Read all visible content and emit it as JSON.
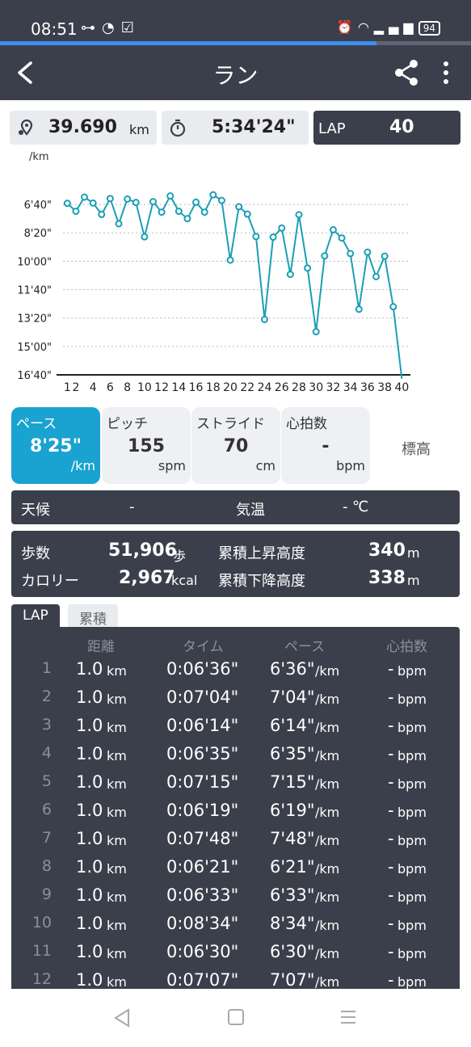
{
  "status": {
    "time": "08:51",
    "battery": "94",
    "progress_fraction": 0.8
  },
  "appbar": {
    "title": "ラン"
  },
  "stats": {
    "distance": "39.690",
    "distance_unit": "km",
    "time": "5:34'24\"",
    "lap_label": "LAP",
    "lap_value": "40"
  },
  "chart_data": {
    "type": "line",
    "ylabel": "/km",
    "y_ticks": [
      "6'40\"",
      "8'20\"",
      "10'00\"",
      "11'40\"",
      "13'20\"",
      "15'00\"",
      "16'40\""
    ],
    "y_tick_values_sec": [
      400,
      500,
      600,
      700,
      800,
      900,
      1000
    ],
    "ylim_sec": [
      340,
      1000
    ],
    "y_inverted": true,
    "x_ticks": [
      "1",
      "2",
      "4",
      "6",
      "8",
      "10",
      "12",
      "14",
      "16",
      "18",
      "20",
      "22",
      "24",
      "26",
      "28",
      "30",
      "32",
      "34",
      "36",
      "38",
      "40"
    ],
    "x_tick_values": [
      1,
      2,
      4,
      6,
      8,
      10,
      12,
      14,
      16,
      18,
      20,
      22,
      24,
      26,
      28,
      30,
      32,
      34,
      36,
      38,
      40
    ],
    "xlim": [
      0.5,
      41
    ],
    "series": [
      {
        "laps": [
          1,
          2,
          3,
          4,
          5,
          6,
          7,
          8,
          9,
          10,
          11,
          12,
          13,
          14,
          15,
          16,
          17,
          18,
          19,
          20,
          21,
          22,
          23,
          24,
          25,
          26,
          27,
          28,
          29,
          30,
          31,
          32,
          33,
          34,
          35,
          36,
          37,
          38,
          39,
          40
        ],
        "values_sec": [
          396,
          424,
          374,
          395,
          435,
          379,
          468,
          381,
          393,
          514,
          390,
          427,
          370,
          424,
          450,
          392,
          427,
          366,
          386,
          596,
          408,
          434,
          513,
          805,
          515,
          483,
          646,
          436,
          624,
          848,
          581,
          489,
          518,
          573,
          769,
          568,
          654,
          582,
          760,
          1100
        ]
      }
    ],
    "line_color": "#1a9fb5"
  },
  "metrics": [
    {
      "label": "ペース",
      "value": "8'25\"",
      "unit": "/km"
    },
    {
      "label": "ピッチ",
      "value": "155",
      "unit": "spm"
    },
    {
      "label": "ストライド",
      "value": "70",
      "unit": "cm"
    },
    {
      "label": "心拍数",
      "value": "-",
      "unit": "bpm"
    },
    {
      "label": "標高"
    }
  ],
  "weather": {
    "label1": "天候",
    "value1": "-",
    "label2": "気温",
    "value2": "-",
    "unit2": "℃"
  },
  "summary": {
    "steps_label": "歩数",
    "steps": "51,906",
    "steps_unit": "歩",
    "cal_label": "カロリー",
    "cal": "2,967",
    "cal_unit": "kcal",
    "up_label": "累積上昇高度",
    "up": "340",
    "up_unit": "m",
    "down_label": "累積下降高度",
    "down": "338",
    "down_unit": "m"
  },
  "tabs": {
    "lap": "LAP",
    "cumulative": "累積"
  },
  "laps": {
    "headers": [
      "距離",
      "タイム",
      "ペース",
      "心拍数"
    ],
    "km_unit": "km",
    "pace_unit": "/km",
    "hr_unit": "bpm",
    "rows": [
      {
        "n": "1",
        "dist": "1.0",
        "time": "0:06'36\"",
        "pace": "6'36\"",
        "hr": "-"
      },
      {
        "n": "2",
        "dist": "1.0",
        "time": "0:07'04\"",
        "pace": "7'04\"",
        "hr": "-"
      },
      {
        "n": "3",
        "dist": "1.0",
        "time": "0:06'14\"",
        "pace": "6'14\"",
        "hr": "-"
      },
      {
        "n": "4",
        "dist": "1.0",
        "time": "0:06'35\"",
        "pace": "6'35\"",
        "hr": "-"
      },
      {
        "n": "5",
        "dist": "1.0",
        "time": "0:07'15\"",
        "pace": "7'15\"",
        "hr": "-"
      },
      {
        "n": "6",
        "dist": "1.0",
        "time": "0:06'19\"",
        "pace": "6'19\"",
        "hr": "-"
      },
      {
        "n": "7",
        "dist": "1.0",
        "time": "0:07'48\"",
        "pace": "7'48\"",
        "hr": "-"
      },
      {
        "n": "8",
        "dist": "1.0",
        "time": "0:06'21\"",
        "pace": "6'21\"",
        "hr": "-"
      },
      {
        "n": "9",
        "dist": "1.0",
        "time": "0:06'33\"",
        "pace": "6'33\"",
        "hr": "-"
      },
      {
        "n": "10",
        "dist": "1.0",
        "time": "0:08'34\"",
        "pace": "8'34\"",
        "hr": "-"
      },
      {
        "n": "11",
        "dist": "1.0",
        "time": "0:06'30\"",
        "pace": "6'30\"",
        "hr": "-"
      },
      {
        "n": "12",
        "dist": "1.0",
        "time": "0:07'07\"",
        "pace": "7'07\"",
        "hr": "-"
      }
    ]
  },
  "icons": {
    "back": "back-arrow-icon",
    "share": "share-icon",
    "more": "more-vert-icon",
    "map_pin": "map-pin-icon",
    "stopwatch": "stopwatch-icon"
  }
}
